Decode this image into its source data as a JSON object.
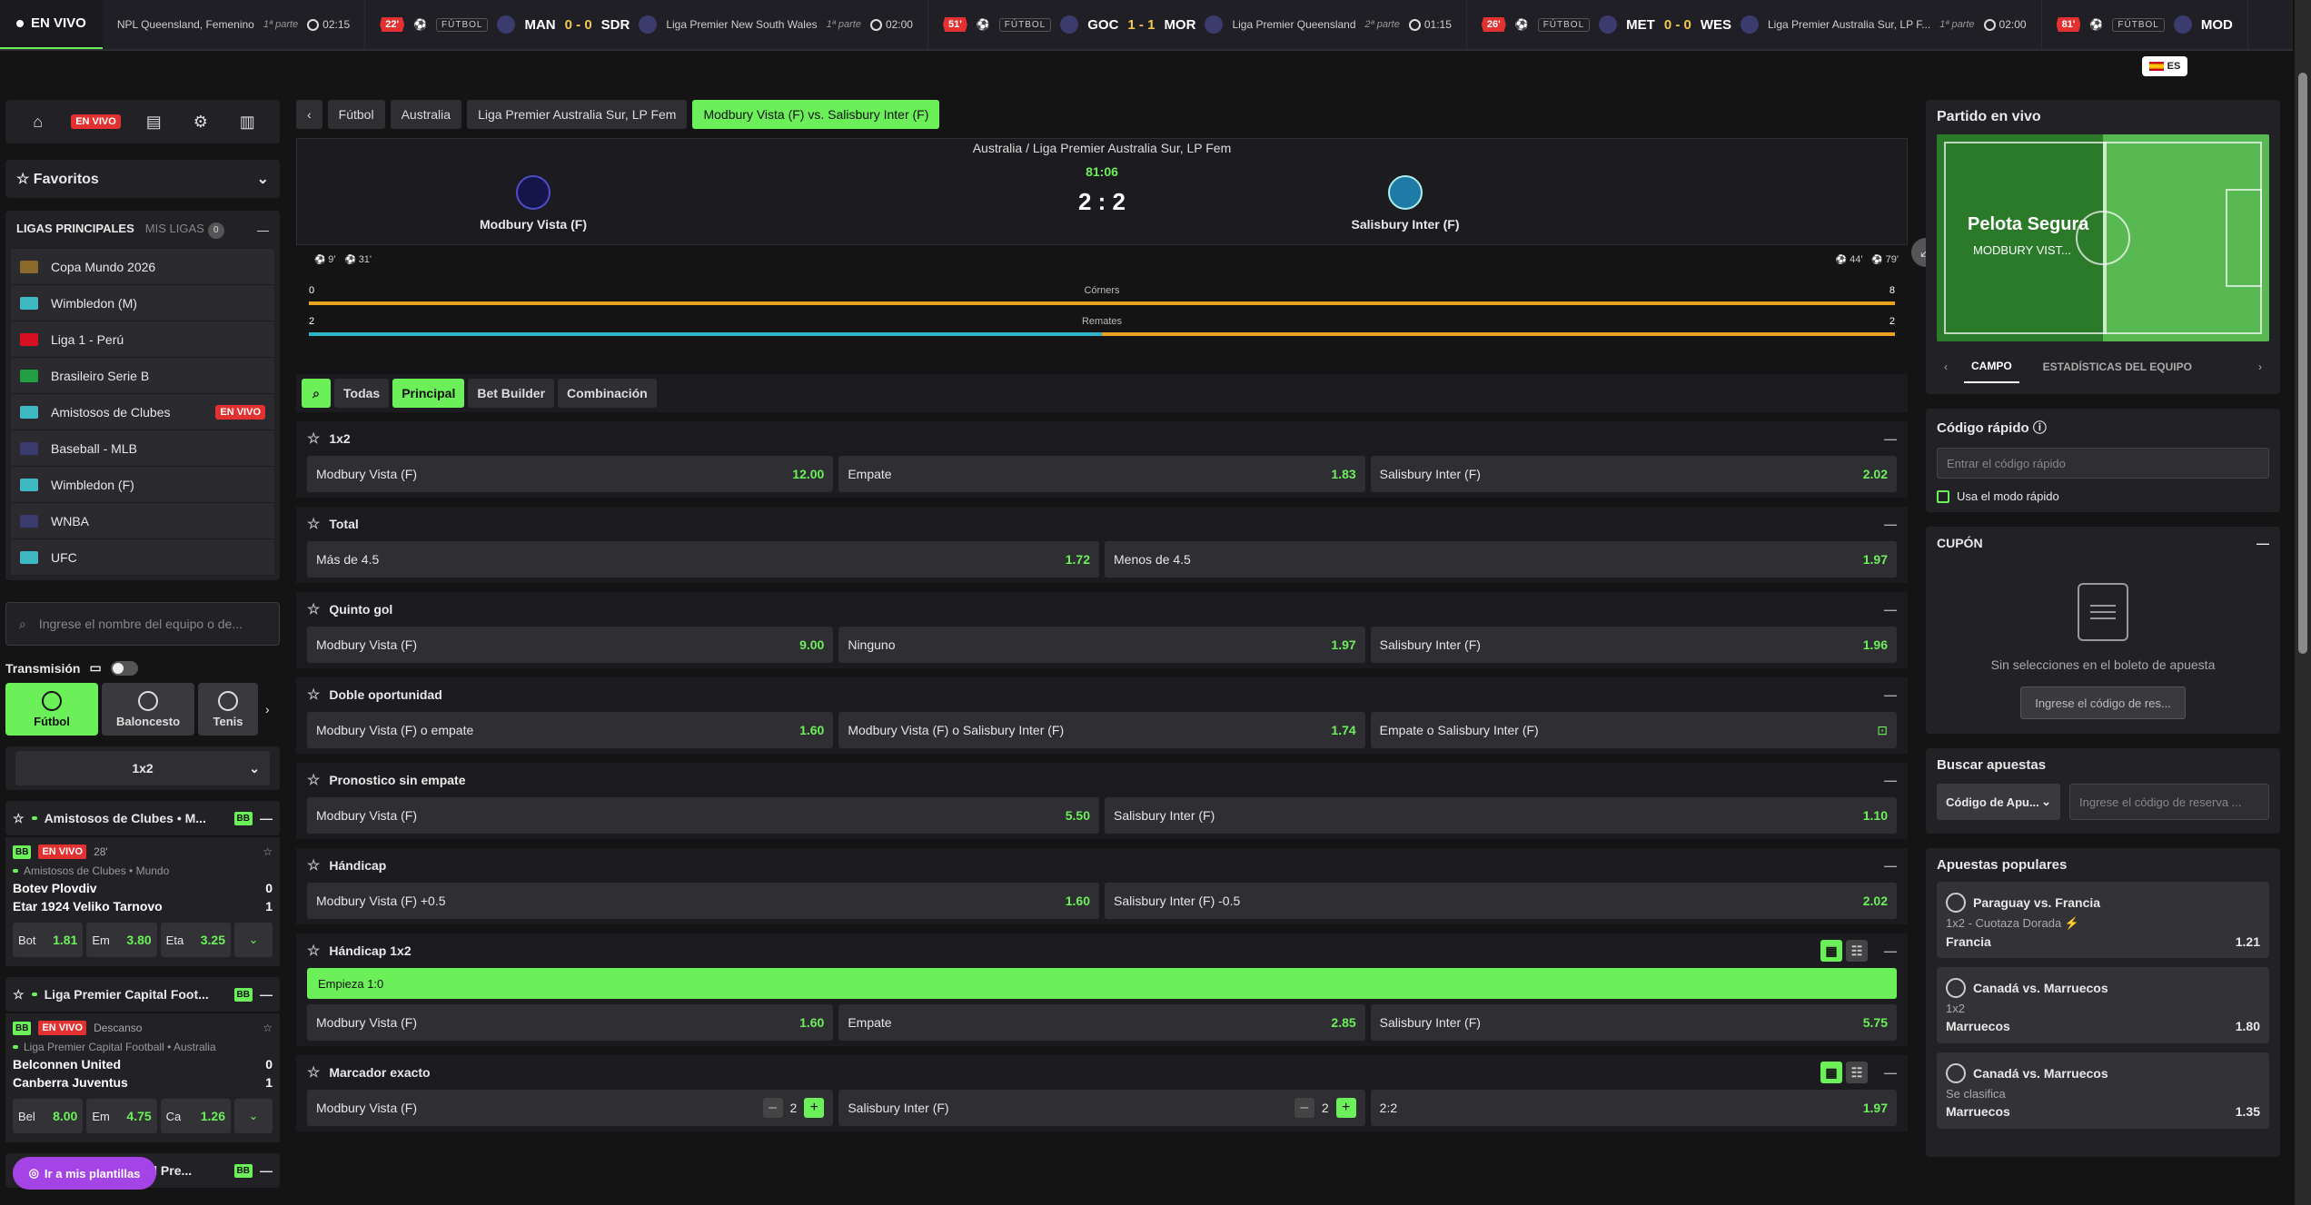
{
  "ticker": {
    "live_label": "EN VIVO",
    "items": [
      {
        "league": "NPL Queensland, Femenino",
        "part": "1ª parte",
        "clock": "02:15"
      },
      {
        "minute": "22'",
        "sport": "FÚTBOL",
        "home": "MAN",
        "score": "0 - 0",
        "away": "SDR",
        "league": "Liga Premier New South Wales",
        "part": "1ª parte",
        "clock": "02:00"
      },
      {
        "minute": "51'",
        "sport": "FÚTBOL",
        "home": "GOC",
        "score": "1 - 1",
        "away": "MOR",
        "league": "Liga Premier Queensland",
        "part": "2ª parte",
        "clock": "01:15"
      },
      {
        "minute": "26'",
        "sport": "FÚTBOL",
        "home": "MET",
        "score": "0 - 0",
        "away": "WES",
        "league": "Liga Premier Australia Sur, LP F...",
        "part": "1ª parte",
        "clock": "02:00"
      },
      {
        "minute": "81'",
        "sport": "FÚTBOL",
        "home": "MOD"
      }
    ],
    "lang": "ES"
  },
  "sidebar": {
    "live_badge": "EN VIVO",
    "favorites": "Favoritos",
    "leagues_header": "LIGAS PRINCIPALES",
    "my_leagues": "MIS LIGAS",
    "my_leagues_count": "0",
    "leagues": [
      {
        "name": "Copa Mundo 2026",
        "flag": "#8a6a2a"
      },
      {
        "name": "Wimbledon (M)",
        "flag": "#3fb8c2"
      },
      {
        "name": "Liga 1 - Perú",
        "flag": "#d91023"
      },
      {
        "name": "Brasileiro Serie B",
        "flag": "#229e45"
      },
      {
        "name": "Amistosos de Clubes",
        "flag": "#3fb8c2",
        "badge": "EN VIVO"
      },
      {
        "name": "Baseball - MLB",
        "flag": "#3c3b6e"
      },
      {
        "name": "Wimbledon (F)",
        "flag": "#3fb8c2"
      },
      {
        "name": "WNBA",
        "flag": "#3c3b6e"
      },
      {
        "name": "UFC",
        "flag": "#3fb8c2"
      }
    ],
    "search_placeholder": "Ingrese el nombre del equipo o de...",
    "transmission": "Transmisión",
    "sports": [
      "Fútbol",
      "Baloncesto",
      "Tenis"
    ],
    "market_select": "1x2",
    "events": [
      {
        "header": "Amistosos de Clubes • M...",
        "live": "EN VIVO",
        "minute": "28'",
        "league": "Amistosos de Clubes • Mundo",
        "home": "Botev Plovdiv",
        "home_score": "0",
        "away": "Etar 1924 Veliko Tarnovo",
        "away_score": "1",
        "odds": [
          {
            "l": "Bot",
            "v": "1.81"
          },
          {
            "l": "Em",
            "v": "3.80"
          },
          {
            "l": "Eta",
            "v": "3.25"
          }
        ]
      },
      {
        "header": "Liga Premier Capital Foot...",
        "live": "EN VIVO",
        "minute": "Descanso",
        "league": "Liga Premier Capital Football • Australia",
        "home": "Belconnen United",
        "home_score": "0",
        "away": "Canberra Juventus",
        "away_score": "1",
        "odds": [
          {
            "l": "Bel",
            "v": "8.00"
          },
          {
            "l": "Em",
            "v": "4.75"
          },
          {
            "l": "Ca",
            "v": "1.26"
          }
        ]
      }
    ],
    "event3_header": "Football Queensland Pre...",
    "bb": "BB",
    "templates_btn": "Ir a mis plantillas"
  },
  "main": {
    "breadcrumbs": [
      "Fútbol",
      "Australia",
      "Liga Premier Australia Sur, LP Fem",
      "Modbury Vista (F) vs. Salisbury Inter (F)"
    ],
    "scoreboard": {
      "league": "Australia / Liga Premier Australia Sur, LP Fem",
      "time": "81:06",
      "score": "2 : 2",
      "home": "Modbury Vista (F)",
      "away": "Salisbury Inter (F)",
      "home_goals": [
        "9'",
        "31'"
      ],
      "away_goals": [
        "44'",
        "79'"
      ]
    },
    "stats": [
      {
        "label": "Córners",
        "home": "0",
        "away": "8",
        "home_share": 0
      },
      {
        "label": "Remates",
        "home": "2",
        "away": "2",
        "home_share": 0.5
      }
    ],
    "filters": [
      "Todas",
      "Principal",
      "Bet Builder",
      "Combinación"
    ],
    "markets": [
      {
        "title": "1x2",
        "cols": 3,
        "odds": [
          [
            "Modbury Vista (F)",
            "12.00"
          ],
          [
            "Empate",
            "1.83"
          ],
          [
            "Salisbury Inter (F)",
            "2.02"
          ]
        ]
      },
      {
        "title": "Total",
        "cols": 2,
        "odds": [
          [
            "Más de 4.5",
            "1.72"
          ],
          [
            "Menos de 4.5",
            "1.97"
          ]
        ]
      },
      {
        "title": "Quinto gol",
        "cols": 3,
        "odds": [
          [
            "Modbury Vista (F)",
            "9.00"
          ],
          [
            "Ninguno",
            "1.97"
          ],
          [
            "Salisbury Inter (F)",
            "1.96"
          ]
        ]
      },
      {
        "title": "Doble oportunidad",
        "cols": 3,
        "odds": [
          [
            "Modbury Vista (F) o empate",
            "1.60"
          ],
          [
            "Modbury Vista (F) o Salisbury Inter (F)",
            "1.74"
          ],
          [
            "Empate o Salisbury Inter (F)",
            ""
          ]
        ]
      },
      {
        "title": "Pronostico sin empate",
        "cols": 2,
        "odds": [
          [
            "Modbury Vista (F)",
            "5.50"
          ],
          [
            "Salisbury Inter (F)",
            "1.10"
          ]
        ]
      },
      {
        "title": "Hándicap",
        "cols": 2,
        "odds": [
          [
            "Modbury Vista (F) +0.5",
            "1.60"
          ],
          [
            "Salisbury Inter (F) -0.5",
            "2.02"
          ]
        ]
      }
    ],
    "handicap1x2": {
      "title": "Hándicap 1x2",
      "banner": "Empieza 1:0",
      "odds": [
        [
          "Modbury Vista (F)",
          "1.60"
        ],
        [
          "Empate",
          "2.85"
        ],
        [
          "Salisbury Inter (F)",
          "5.75"
        ]
      ]
    },
    "exact": {
      "title": "Marcador exacto",
      "home": "Modbury Vista (F)",
      "home_val": "2",
      "away": "Salisbury Inter (F)",
      "away_val": "2",
      "result": "2:2",
      "odd": "1.97"
    }
  },
  "right": {
    "live_title": "Partido en vivo",
    "pitch_title": "Pelota Segura",
    "pitch_team": "MODBURY VIST...",
    "tabs": [
      "CAMPO",
      "ESTADÍSTICAS DEL EQUIPO"
    ],
    "quick_title": "Código rápido",
    "quick_placeholder": "Entrar el código rápido",
    "quick_mode": "Usa el modo rápido",
    "coupon_title": "CUPÓN",
    "coupon_empty": "Sin selecciones en el boleto de apuesta",
    "coupon_btn": "Ingrese el código de res...",
    "find_title": "Buscar apuestas",
    "find_select": "Código de Apu...",
    "find_placeholder": "Ingrese el código de reserva ...",
    "popular_title": "Apuestas populares",
    "popular": [
      {
        "match": "Paraguay vs. Francia",
        "market": "1x2 - Cuotaza Dorada",
        "pick": "Francia",
        "odd": "1.21",
        "bolt": true
      },
      {
        "match": "Canadá vs. Marruecos",
        "market": "1x2",
        "pick": "Marruecos",
        "odd": "1.80"
      },
      {
        "match": "Canadá vs. Marruecos",
        "market": "Se clasifica",
        "pick": "Marruecos",
        "odd": "1.35"
      }
    ]
  }
}
